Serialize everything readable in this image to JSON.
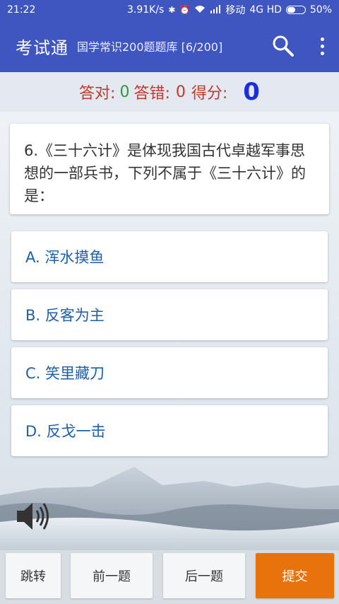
{
  "status_bar": {
    "time": "21:22",
    "net_speed": "3.91K/s",
    "carrier": "移动",
    "network": "4G HD",
    "battery": "50%",
    "battery_level": 0.5
  },
  "app_bar": {
    "title": "考试通",
    "subtitle": "国学常识200题题库 [6/200]",
    "icons": [
      "search-icon",
      "more-vert-icon"
    ]
  },
  "score": {
    "correct_label": "答对:",
    "correct_value": "0",
    "wrong_label": "答错:",
    "wrong_value": "0",
    "score_label": "得分:",
    "score_value": "0"
  },
  "question": {
    "text": "6.《三十六计》是体现我国古代卓越军事思想的一部兵书，下列不属于《三十六计》的是："
  },
  "options": [
    {
      "label": "A. 浑水摸鱼"
    },
    {
      "label": "B. 反客为主"
    },
    {
      "label": "C. 笑里藏刀"
    },
    {
      "label": "D. 反戈一击"
    }
  ],
  "bottom_buttons": {
    "jump": "跳转",
    "prev": "前一题",
    "next": "后一题",
    "submit": "提交"
  },
  "colors": {
    "primary": "#3f56c0",
    "option_text": "#1d5fa8",
    "submit": "#e8720c",
    "score_value": "#1a2ee0",
    "correct": "#2e9b3a",
    "wrong": "#c0392b"
  }
}
